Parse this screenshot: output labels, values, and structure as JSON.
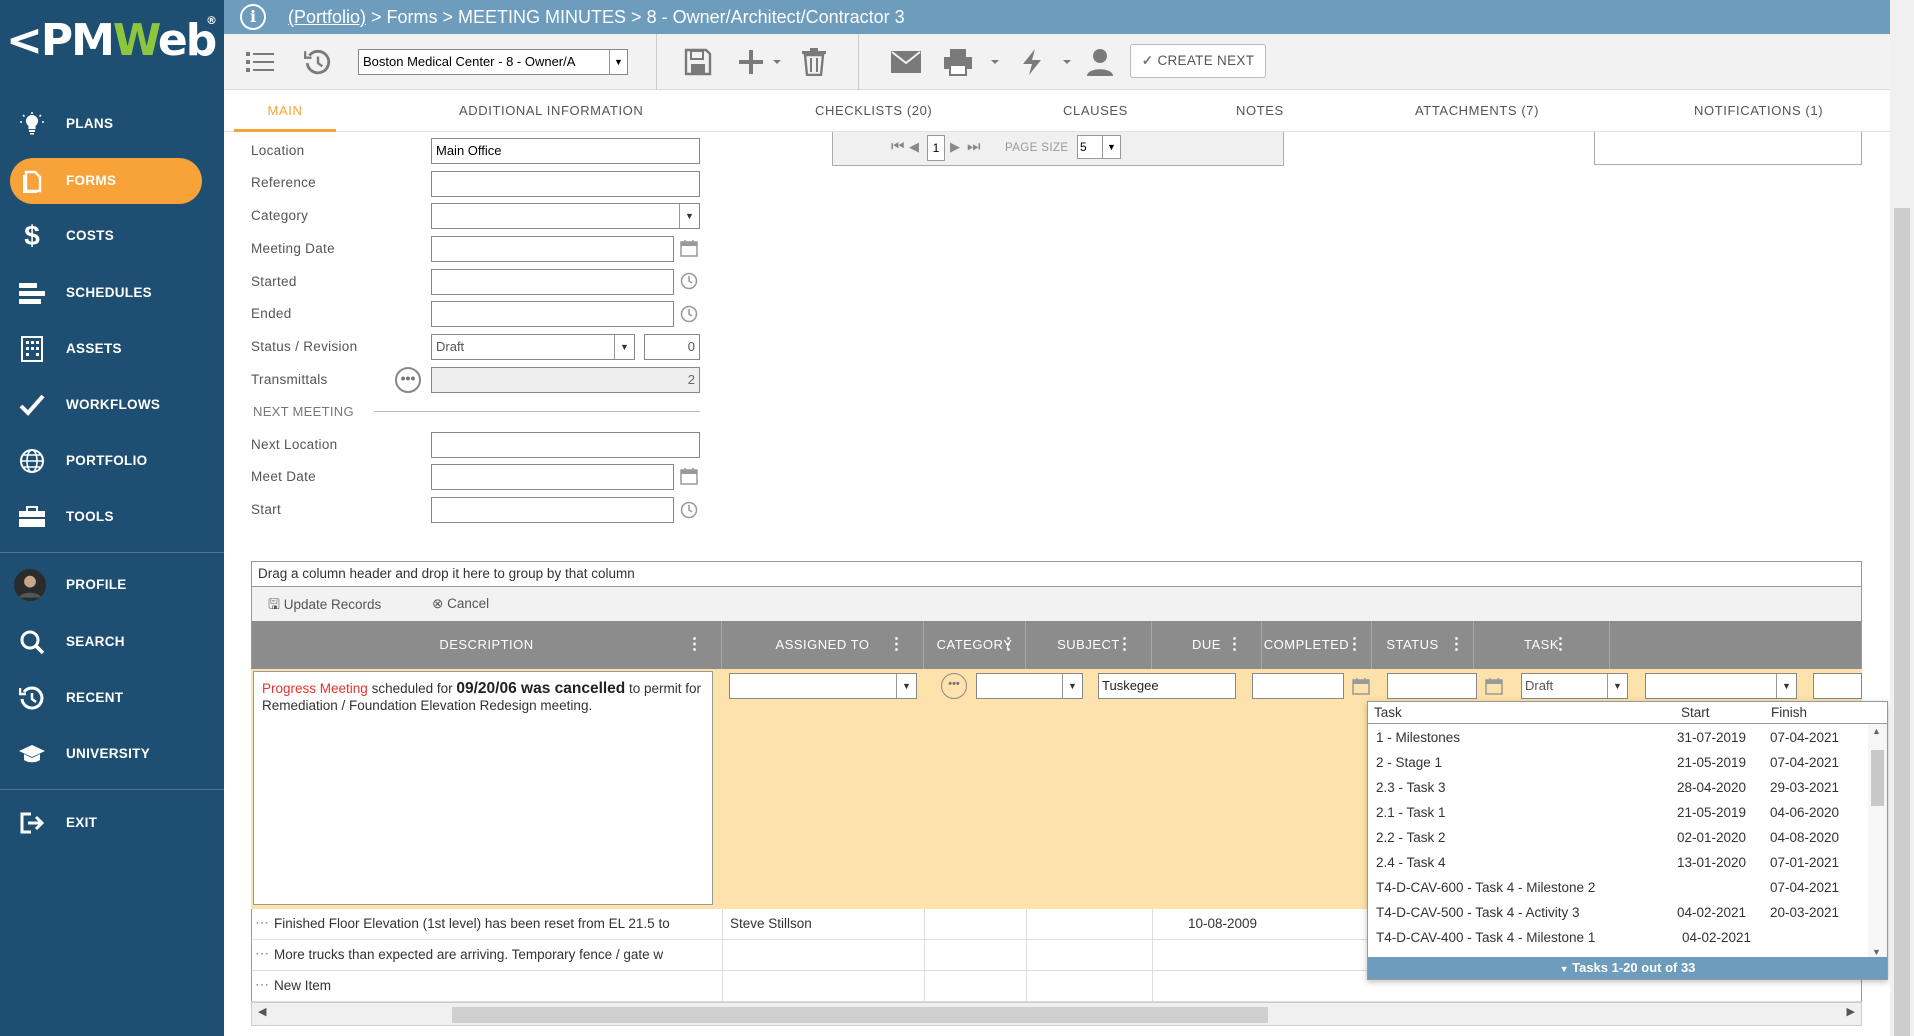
{
  "app": {
    "logo_text_a": "<PM",
    "logo_text_b": "W",
    "logo_text_c": "eb",
    "logo_reg": "®"
  },
  "sidebar": {
    "items": [
      {
        "label": "PLANS",
        "icon": "lightbulb-icon"
      },
      {
        "label": "FORMS",
        "icon": "document-icon",
        "active": true
      },
      {
        "label": "COSTS",
        "icon": "dollar-icon"
      },
      {
        "label": "SCHEDULES",
        "icon": "schedule-bars-icon"
      },
      {
        "label": "ASSETS",
        "icon": "building-icon"
      },
      {
        "label": "WORKFLOWS",
        "icon": "checkmark-icon"
      },
      {
        "label": "PORTFOLIO",
        "icon": "globe-icon"
      },
      {
        "label": "TOOLS",
        "icon": "toolbox-icon"
      },
      {
        "label": "PROFILE",
        "icon": "avatar-icon"
      },
      {
        "label": "SEARCH",
        "icon": "search-icon"
      },
      {
        "label": "RECENT",
        "icon": "history-icon"
      },
      {
        "label": "UNIVERSITY",
        "icon": "graduation-cap-icon"
      },
      {
        "label": "EXIT",
        "icon": "exit-icon"
      }
    ]
  },
  "breadcrumb": {
    "portfolio": "(Portfolio)",
    "rest": " > Forms > MEETING MINUTES > 8 - Owner/Architect/Contractor 3"
  },
  "toolbar": {
    "project_select": "Boston Medical Center - 8 - Owner/A",
    "create_next": "CREATE NEXT"
  },
  "tabs": [
    "MAIN",
    "ADDITIONAL INFORMATION",
    "CHECKLISTS (20)",
    "CLAUSES",
    "NOTES",
    "ATTACHMENTS (7)",
    "NOTIFICATIONS (1)"
  ],
  "form": {
    "location_label": "Location",
    "location_value": "Main Office",
    "reference_label": "Reference",
    "category_label": "Category",
    "meeting_date_label": "Meeting Date",
    "started_label": "Started",
    "ended_label": "Ended",
    "status_label": "Status / Revision",
    "status_value": "Draft",
    "revision_value": "0",
    "transmittals_label": "Transmittals",
    "transmittals_value": "2",
    "next_meeting_header": "NEXT MEETING",
    "next_location_label": "Next Location",
    "meet_date_label": "Meet Date",
    "start_label": "Start"
  },
  "pager": {
    "page": "1",
    "page_size_label": "PAGE SIZE",
    "page_size": "5"
  },
  "grid": {
    "group_hint": "Drag a column header and drop it here to group by that column",
    "update_records": "Update Records",
    "cancel": "Cancel",
    "columns": [
      "DESCRIPTION",
      "ASSIGNED TO",
      "CATEGORY",
      "SUBJECT",
      "DUE",
      "COMPLETED",
      "STATUS",
      "TASK"
    ],
    "edit_row": {
      "desc_red": "Progress Meeting",
      "desc_mid": " scheduled for ",
      "desc_bold": "09/20/06 was cancelled",
      "desc_end": " to permit for Remediation / Foundation Elevation Redesign meeting.",
      "subject": "Tuskegee",
      "status": "Draft"
    },
    "rows": [
      {
        "description": "Finished Floor Elevation (1st level) has been reset from EL 21.5 to",
        "assigned_to": "Steve Stillson",
        "due": "10-08-2009"
      },
      {
        "description": "More trucks than expected are arriving. Temporary fence / gate w",
        "assigned_to": "",
        "due": ""
      },
      {
        "description": "New Item",
        "assigned_to": "",
        "due": ""
      }
    ]
  },
  "task_dropdown": {
    "headers": {
      "task": "Task",
      "start": "Start",
      "finish": "Finish"
    },
    "rows": [
      {
        "task": "1 - Milestones",
        "start": "31-07-2019",
        "finish": "07-04-2021"
      },
      {
        "task": "2 - Stage 1",
        "start": "21-05-2019",
        "finish": "07-04-2021"
      },
      {
        "task": "2.3 - Task 3",
        "start": "28-04-2020",
        "finish": "29-03-2021"
      },
      {
        "task": "2.1 - Task 1",
        "start": "21-05-2019",
        "finish": "04-06-2020"
      },
      {
        "task": "2.2 - Task 2",
        "start": "02-01-2020",
        "finish": "04-08-2020"
      },
      {
        "task": "2.4 - Task 4",
        "start": "13-01-2020",
        "finish": "07-01-2021"
      },
      {
        "task": "T4-D-CAV-600 - Task 4 - Milestone 2",
        "start": "",
        "finish": "07-04-2021"
      },
      {
        "task": "T4-D-CAV-500 - Task 4 - Activity 3",
        "start": "04-02-2021",
        "finish": "20-03-2021"
      },
      {
        "task": "T4-D-CAV-400 - Task 4 - Milestone 1",
        "start": "04-02-2021",
        "finish": ""
      }
    ],
    "footer": "Tasks 1-20 out of 33"
  },
  "colors": {
    "sidebar": "#1e4f72",
    "accent": "#f8a23a",
    "topbar": "#6d9cbd",
    "edit_row": "#fde3ab"
  }
}
